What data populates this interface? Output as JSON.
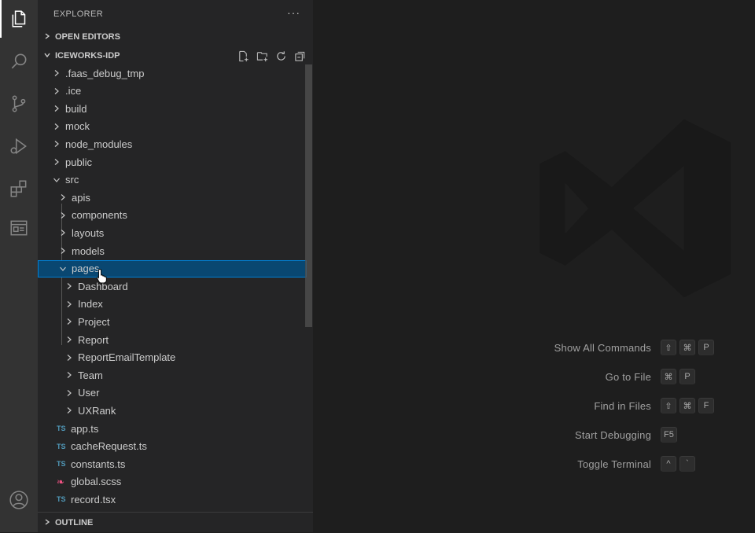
{
  "activity_bar": {
    "icons": [
      "files-icon",
      "search-icon",
      "source-control-icon",
      "run-debug-icon",
      "extensions-icon",
      "browser-preview-icon",
      "account-icon"
    ]
  },
  "sidebar": {
    "header": "EXPLORER",
    "more": "···",
    "open_editors": "OPEN EDITORS",
    "project": "ICEWORKS-IDP",
    "outline": "OUTLINE",
    "tree": [
      {
        "label": ".faas_debug_tmp",
        "type": "folder",
        "expanded": false
      },
      {
        "label": ".ice",
        "type": "folder",
        "expanded": false
      },
      {
        "label": "build",
        "type": "folder",
        "expanded": false
      },
      {
        "label": "mock",
        "type": "folder",
        "expanded": false
      },
      {
        "label": "node_modules",
        "type": "folder",
        "expanded": false
      },
      {
        "label": "public",
        "type": "folder",
        "expanded": false
      },
      {
        "label": "src",
        "type": "folder",
        "expanded": true
      },
      {
        "label": "apis",
        "type": "folder",
        "expanded": false
      },
      {
        "label": "components",
        "type": "folder",
        "expanded": false
      },
      {
        "label": "layouts",
        "type": "folder",
        "expanded": false
      },
      {
        "label": "models",
        "type": "folder",
        "expanded": false
      },
      {
        "label": "pages",
        "type": "folder",
        "expanded": true,
        "selected": true
      },
      {
        "label": "Dashboard",
        "type": "folder",
        "expanded": false
      },
      {
        "label": "Index",
        "type": "folder",
        "expanded": false
      },
      {
        "label": "Project",
        "type": "folder",
        "expanded": false
      },
      {
        "label": "Report",
        "type": "folder",
        "expanded": false
      },
      {
        "label": "ReportEmailTemplate",
        "type": "folder",
        "expanded": false
      },
      {
        "label": "Team",
        "type": "folder",
        "expanded": false
      },
      {
        "label": "User",
        "type": "folder",
        "expanded": false
      },
      {
        "label": "UXRank",
        "type": "folder",
        "expanded": false
      },
      {
        "label": "app.ts",
        "type": "file",
        "icon": "TS"
      },
      {
        "label": "cacheRequest.ts",
        "type": "file",
        "icon": "TS"
      },
      {
        "label": "constants.ts",
        "type": "file",
        "icon": "TS"
      },
      {
        "label": "global.scss",
        "type": "file",
        "icon": "scss"
      },
      {
        "label": "record.tsx",
        "type": "file",
        "icon": "TS"
      }
    ]
  },
  "editor": {
    "shortcuts": [
      {
        "label": "Show All Commands",
        "keys": [
          "⇧",
          "⌘",
          "P"
        ]
      },
      {
        "label": "Go to File",
        "keys": [
          "⌘",
          "P"
        ]
      },
      {
        "label": "Find in Files",
        "keys": [
          "⇧",
          "⌘",
          "F"
        ]
      },
      {
        "label": "Start Debugging",
        "keys": [
          "F5"
        ]
      },
      {
        "label": "Toggle Terminal",
        "keys": [
          "^",
          "`"
        ]
      }
    ]
  },
  "colors": {
    "selection": "#094771",
    "selection_border": "#007fd4",
    "ts_icon": "#519aba",
    "scss_icon": "#f55385"
  }
}
